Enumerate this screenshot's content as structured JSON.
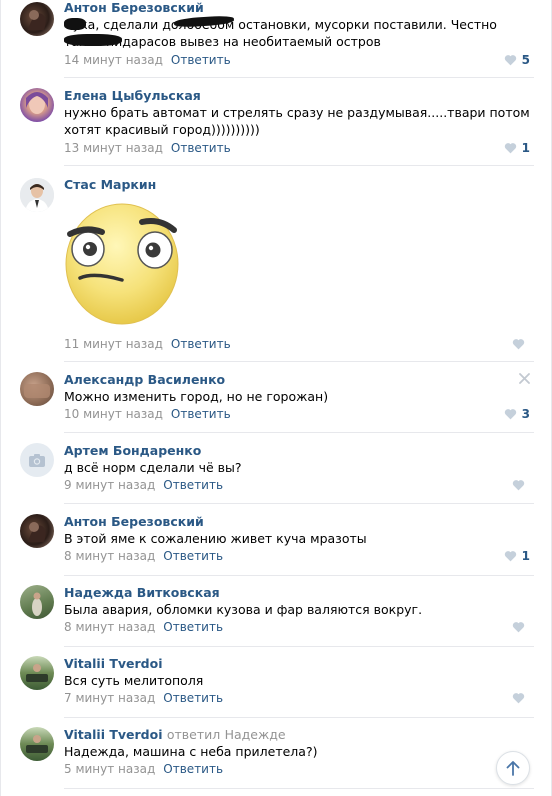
{
  "comments": [
    {
      "author": "Антон Березовский",
      "text": "Сука, сделали долбоебом остановки, мусорки поставили. Честно таких пидарасов вывез на необитаемый остров",
      "time": "14 минут назад",
      "reply": "Ответить",
      "likes": "5"
    },
    {
      "author": "Елена Цыбульская",
      "text": "нужно брать автомат и стрелять сразу не раздумывая.....твари потом хотят красивый город))))))))))",
      "time": "13 минут назад",
      "reply": "Ответить",
      "likes": "1"
    },
    {
      "author": "Стас Маркин",
      "text": "",
      "sticker": "suspicious-face-sticker",
      "time": "11 минут назад",
      "reply": "Ответить",
      "likes": ""
    },
    {
      "author": "Александр Василенко",
      "text": "Можно изменить город, но не горожан)",
      "time": "10 минут назад",
      "reply": "Ответить",
      "likes": "3"
    },
    {
      "author": "Артем Бондаренко",
      "text": "д всё норм сделали чё вы?",
      "time": "9 минут назад",
      "reply": "Ответить",
      "likes": ""
    },
    {
      "author": "Антон Березовский",
      "text": "В этой яме к сожалению живет куча мразоты",
      "time": "8 минут назад",
      "reply": "Ответить",
      "likes": "1"
    },
    {
      "author": "Надежда Витковская",
      "text": "Была авария, обломки кузова и фар валяются вокруг.",
      "time": "8 минут назад",
      "reply": "Ответить",
      "likes": ""
    },
    {
      "author": "Vitalii Tverdoi",
      "text": "Вся суть мелитополя",
      "time": "7 минут назад",
      "reply": "Ответить",
      "likes": ""
    },
    {
      "author": "Vitalii Tverdoi",
      "reply_to_label": "ответил",
      "reply_to_name": "Надежде",
      "text": "Надежда, машина с неба прилетела?)",
      "time": "5 минут назад",
      "reply": "Ответить",
      "likes": ""
    }
  ],
  "icons": {
    "like": "heart-icon",
    "close": "close-icon",
    "scroll_up": "arrow-up-icon",
    "no_photo": "camera-icon"
  },
  "colors": {
    "link": "#2a5885",
    "meta": "#939393",
    "like_inactive": "#c5d0db",
    "divider": "#e7e8ec"
  }
}
